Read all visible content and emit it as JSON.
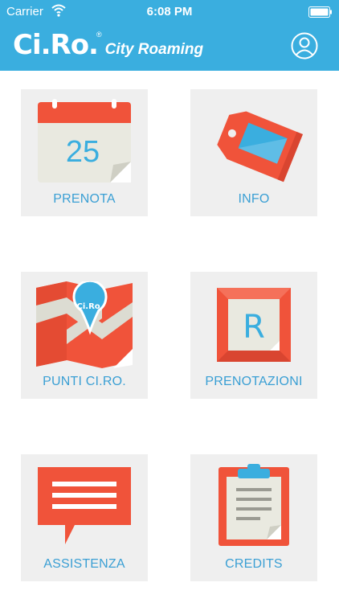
{
  "status_bar": {
    "carrier": "Carrier",
    "time": "6:08 PM"
  },
  "header": {
    "logo_text": "Ci.Ro.",
    "logo_mark": "®",
    "logo_subtitle": "City Roaming",
    "profile_icon": "user-profile-icon"
  },
  "menu": {
    "prenota": {
      "label": "PRENOTA",
      "day": "25",
      "icon": "calendar-icon"
    },
    "info": {
      "label": "INFO",
      "icon": "tag-icon"
    },
    "punti": {
      "label": "PUNTI CI.RO.",
      "pin_text": "Ci.Ro.",
      "icon": "map-pin-icon"
    },
    "prenotazioni": {
      "label": "PRENOTAZIONI",
      "letter": "R",
      "icon": "framed-r-icon"
    },
    "assistenza": {
      "label": "ASSISTENZA",
      "icon": "chat-bubble-icon"
    },
    "credits": {
      "label": "CREDITS",
      "icon": "clipboard-icon"
    }
  },
  "colors": {
    "header_blue": "#3aaedf",
    "accent_orange": "#f0533a",
    "label_blue": "#3a9fd4",
    "tile_bg": "#efefef"
  }
}
